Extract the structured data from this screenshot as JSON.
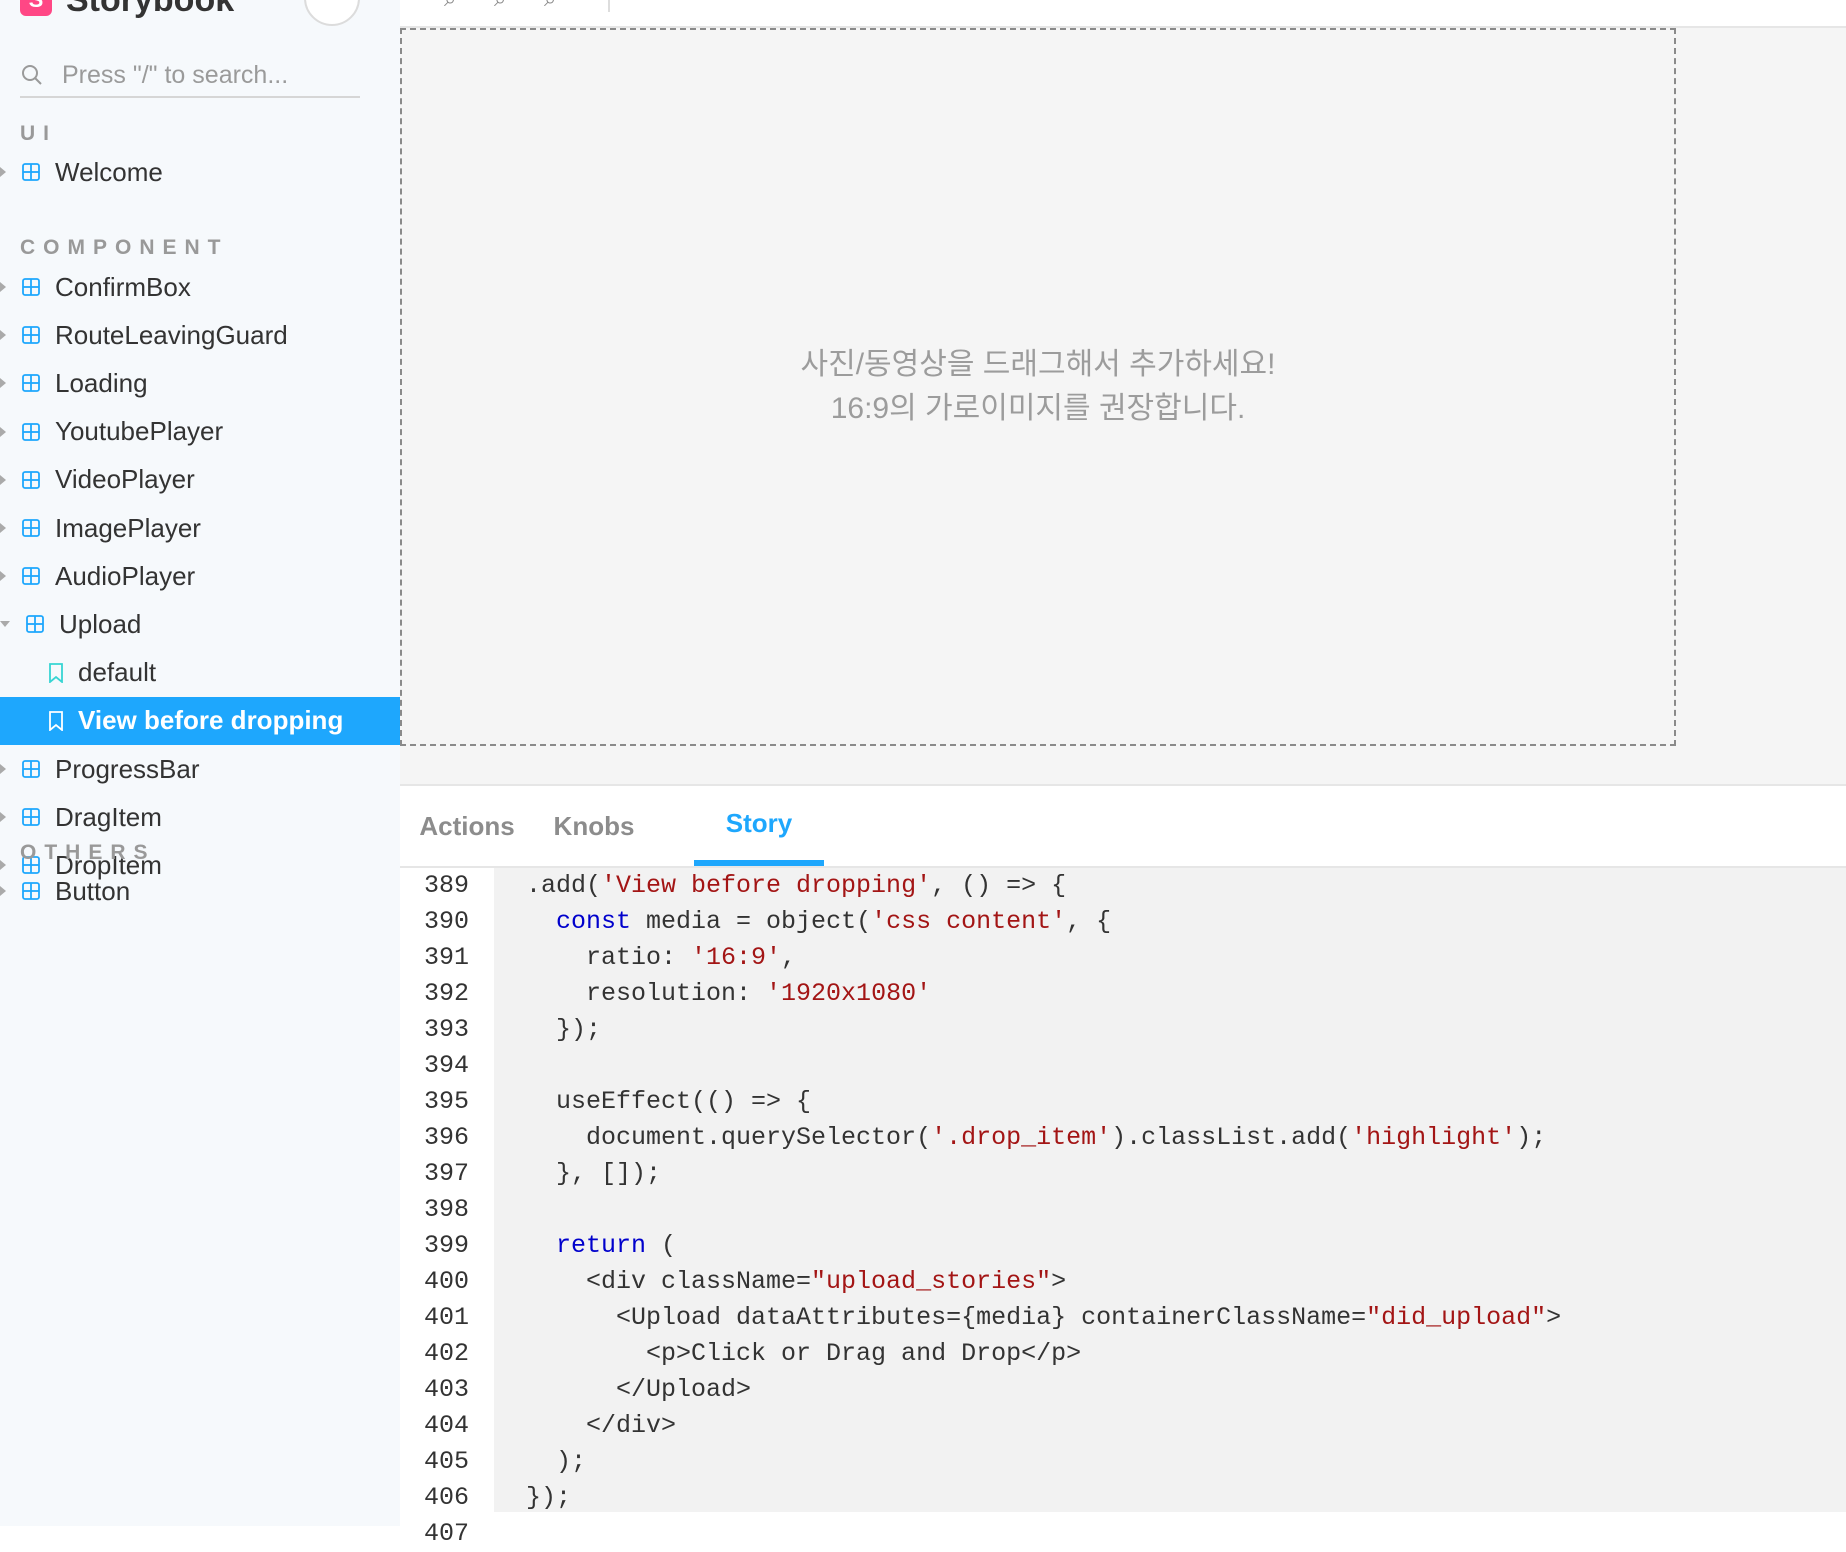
{
  "app": {
    "logo_letter": "S",
    "name": "Storybook"
  },
  "search": {
    "placeholder": "Press \"/\" to search..."
  },
  "sidebar": {
    "sections": [
      {
        "title": "UI",
        "items": [
          {
            "label": "Welcome"
          }
        ]
      },
      {
        "title": "COMPONENT",
        "items": [
          {
            "label": "ConfirmBox"
          },
          {
            "label": "RouteLeavingGuard"
          },
          {
            "label": "Loading"
          },
          {
            "label": "YoutubePlayer"
          },
          {
            "label": "VideoPlayer"
          },
          {
            "label": "ImagePlayer"
          },
          {
            "label": "AudioPlayer"
          },
          {
            "label": "Upload",
            "expanded": true,
            "stories": [
              {
                "label": "default"
              },
              {
                "label": "View before dropping",
                "selected": true
              }
            ]
          },
          {
            "label": "ProgressBar"
          },
          {
            "label": "DragItem"
          },
          {
            "label": "DropItem"
          }
        ]
      },
      {
        "title": "OTHERS",
        "items": [
          {
            "label": "Button"
          }
        ]
      }
    ]
  },
  "preview": {
    "line1": "사진/동영상을 드래그해서 추가하세요!",
    "line2": "16:9의 가로이미지를 권장합니다."
  },
  "addons": {
    "tabs": [
      {
        "label": "Actions",
        "active": false
      },
      {
        "label": "Knobs",
        "active": false
      },
      {
        "label": "Story",
        "active": true
      }
    ]
  },
  "code": {
    "lines": [
      {
        "n": "389",
        "t": ".add('View before dropping', () => {"
      },
      {
        "n": "390",
        "t": "  const media = object('css content', {"
      },
      {
        "n": "391",
        "t": "    ratio: '16:9',"
      },
      {
        "n": "392",
        "t": "    resolution: '1920x1080'"
      },
      {
        "n": "393",
        "t": "  });"
      },
      {
        "n": "394",
        "t": ""
      },
      {
        "n": "395",
        "t": "  useEffect(() => {"
      },
      {
        "n": "396",
        "t": "    document.querySelector('.drop_item').classList.add('highlight');"
      },
      {
        "n": "397",
        "t": "  }, []);"
      },
      {
        "n": "398",
        "t": ""
      },
      {
        "n": "399",
        "t": "  return ("
      },
      {
        "n": "400",
        "t": "    <div className=\"upload_stories\">"
      },
      {
        "n": "401",
        "t": "      <Upload dataAttributes={media} containerClassName=\"did_upload\">"
      },
      {
        "n": "402",
        "t": "        <p>Click or Drag and Drop</p>"
      },
      {
        "n": "403",
        "t": "      </Upload>"
      },
      {
        "n": "404",
        "t": "    </div>"
      },
      {
        "n": "405",
        "t": "  );"
      },
      {
        "n": "406",
        "t": "});"
      },
      {
        "n": "407",
        "t": ""
      }
    ]
  },
  "colors": {
    "accent": "#1ea7fd",
    "brand": "#ff4785",
    "keyword": "#0000cc",
    "string": "#a31515"
  }
}
